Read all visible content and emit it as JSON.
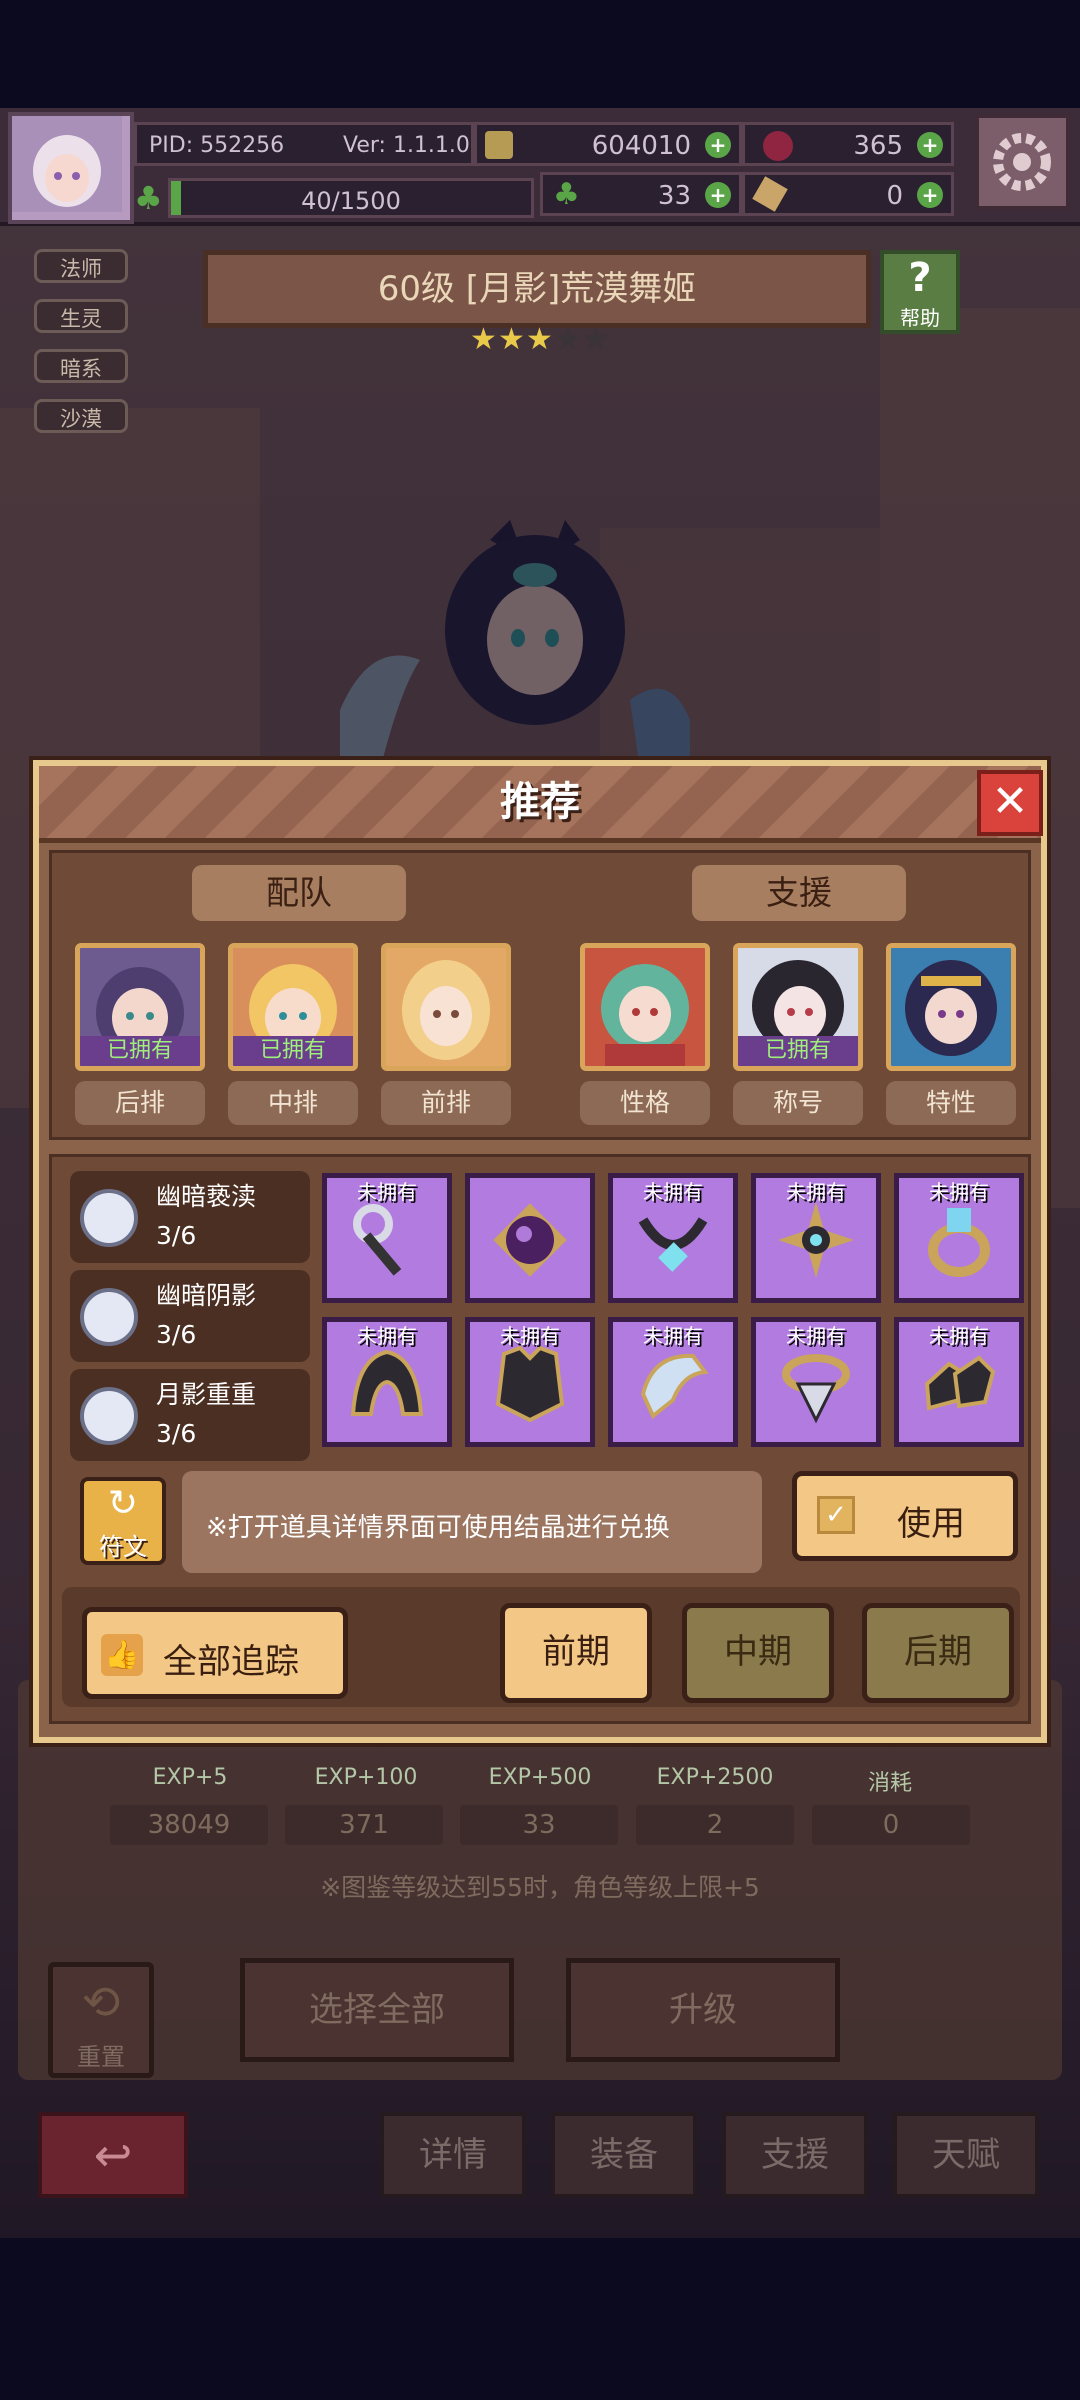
{
  "header": {
    "pid": "PID: 552256",
    "version": "Ver: 1.1.1.0",
    "gold": "604010",
    "gems": "365",
    "stamina": "40/1500",
    "clover": "33",
    "hammer": "0",
    "stamina_fill": 0.027
  },
  "left_tags": [
    "法师",
    "生灵",
    "暗系",
    "沙漠"
  ],
  "character": {
    "title": "60级 [月影]荒漠舞姬",
    "stars": 5,
    "stars_filled": 3,
    "help_label": "帮助"
  },
  "modal": {
    "title": "推荐",
    "team_header": "配队",
    "support_header": "支援",
    "team": [
      {
        "owned_label": "已拥有",
        "position": "后排",
        "owned": true
      },
      {
        "owned_label": "已拥有",
        "position": "中排",
        "owned": true
      },
      {
        "owned_label": "",
        "position": "前排",
        "owned": false
      }
    ],
    "support": [
      {
        "owned_label": "",
        "position": "性格",
        "owned": false
      },
      {
        "owned_label": "已拥有",
        "position": "称号",
        "owned": true
      },
      {
        "owned_label": "",
        "position": "特性",
        "owned": false
      }
    ],
    "sets": [
      {
        "name": "幽暗亵渎",
        "count": "3/6"
      },
      {
        "name": "幽暗阴影",
        "count": "3/6"
      },
      {
        "name": "月影重重",
        "count": "3/6"
      }
    ],
    "items_row1": [
      {
        "label": "未拥有",
        "icon": "wrench-icon"
      },
      {
        "label": "",
        "icon": "dark-orb-icon"
      },
      {
        "label": "未拥有",
        "icon": "necklace-icon"
      },
      {
        "label": "未拥有",
        "icon": "emblem-icon"
      },
      {
        "label": "未拥有",
        "icon": "ring-icon"
      }
    ],
    "items_row2": [
      {
        "label": "未拥有",
        "icon": "helmet-icon"
      },
      {
        "label": "未拥有",
        "icon": "armor-icon"
      },
      {
        "label": "未拥有",
        "icon": "gauntlet-icon"
      },
      {
        "label": "未拥有",
        "icon": "gem-ring-icon"
      },
      {
        "label": "未拥有",
        "icon": "boots-icon"
      }
    ],
    "rune_label": "符文",
    "hint": "※打开道具详情界面可使用结晶进行兑换",
    "use_label": "使用",
    "track_all_label": "全部追踪",
    "stages": [
      "前期",
      "中期",
      "后期"
    ]
  },
  "background": {
    "exp_labels": [
      "EXP+5",
      "EXP+100",
      "EXP+500",
      "EXP+2500",
      "消耗"
    ],
    "exp_values": [
      "38049",
      "371",
      "33",
      "2",
      "0"
    ],
    "note": "※图鉴等级达到55时，角色等级上限+5",
    "reset_label": "重置",
    "select_all_label": "选择全部",
    "upgrade_label": "升级",
    "tabs": [
      "详情",
      "装备",
      "支援",
      "天赋"
    ]
  },
  "colors": {
    "accent_gold": "#f3c887",
    "item_purple": "#b27be0",
    "owned_green": "#9ff07a"
  }
}
